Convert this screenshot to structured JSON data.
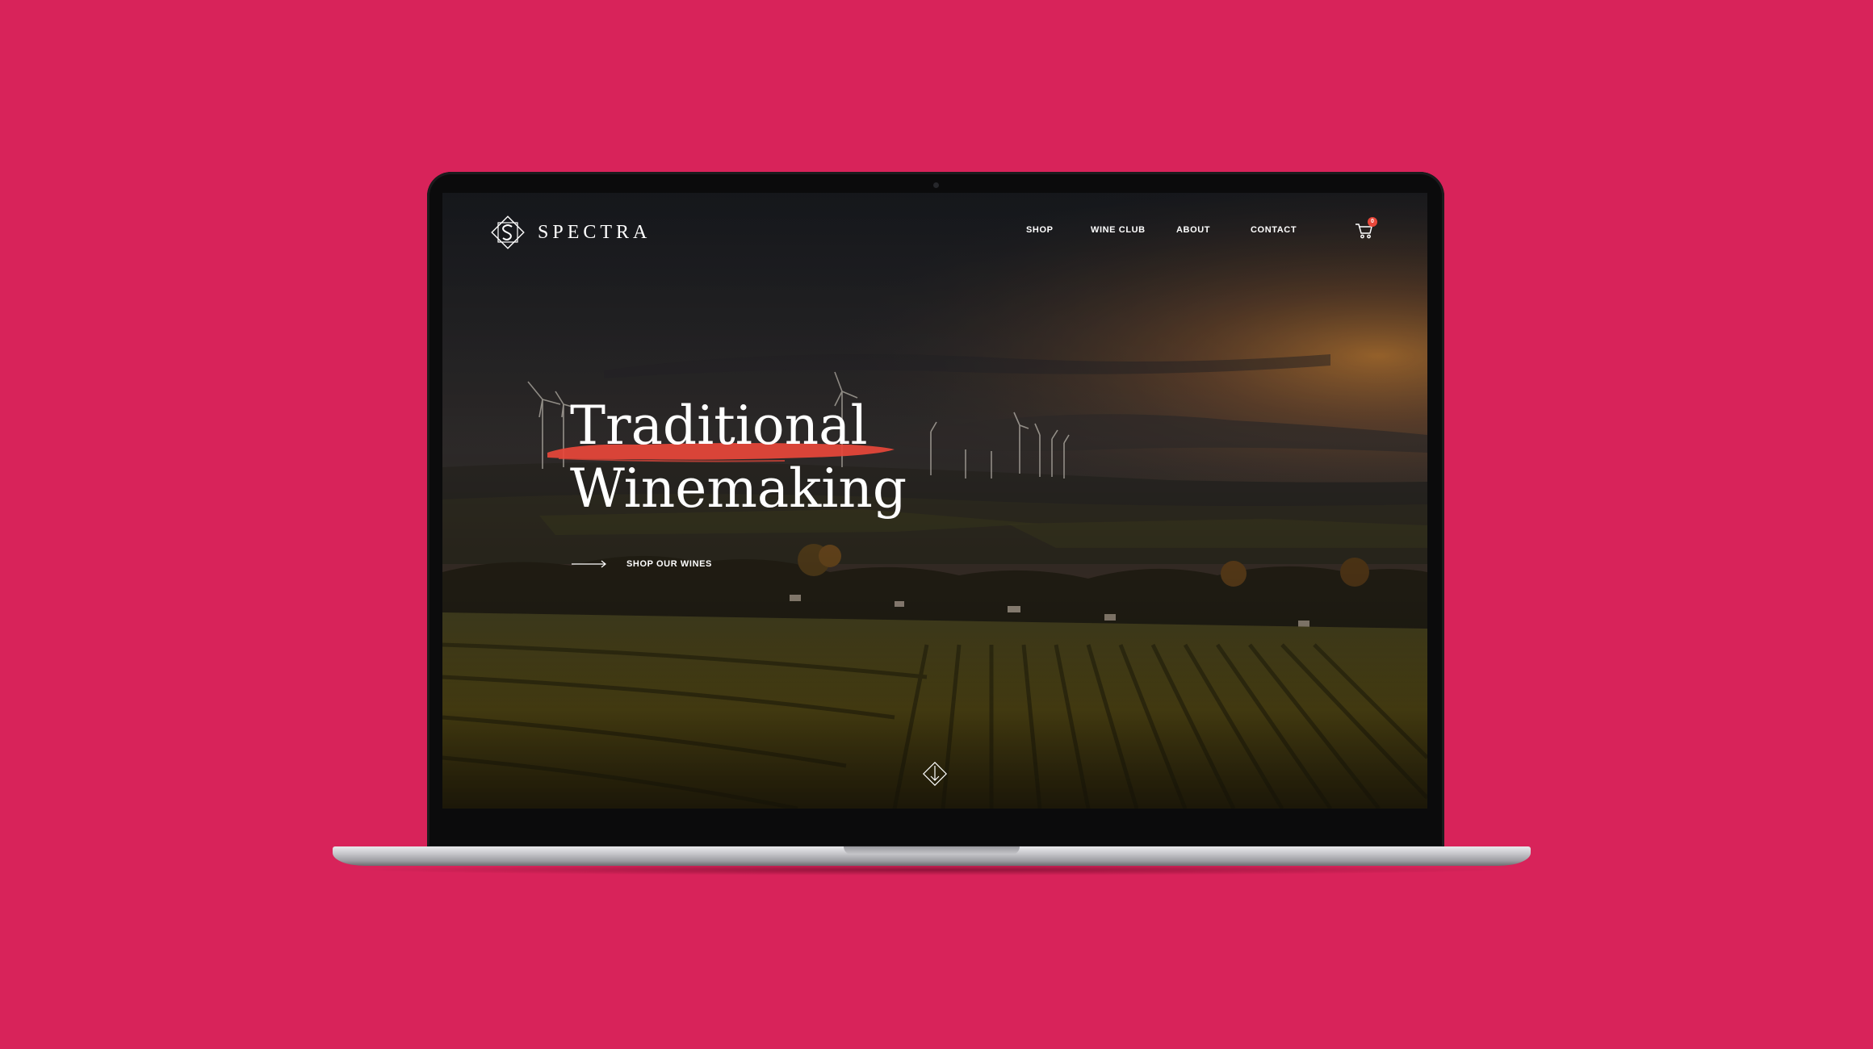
{
  "site": {
    "brand": "SPECTRA",
    "logo_icon": "s-monogram-diamond-icon"
  },
  "nav": {
    "items": [
      {
        "label": "SHOP"
      },
      {
        "label": "WINE CLUB"
      },
      {
        "label": "ABOUT"
      },
      {
        "label": "CONTACT"
      }
    ],
    "cart_icon": "shopping-cart-icon",
    "cart_count": "0"
  },
  "hero": {
    "title_line_1": "Traditional",
    "title_line_2": "Winemaking",
    "cta_label": "SHOP OUR WINES",
    "cta_icon": "long-arrow-right-icon",
    "scroll_icon": "diamond-arrow-down-icon"
  },
  "colors": {
    "backdrop": "#d8235a",
    "accent": "#e8473a",
    "text": "#ffffff"
  }
}
